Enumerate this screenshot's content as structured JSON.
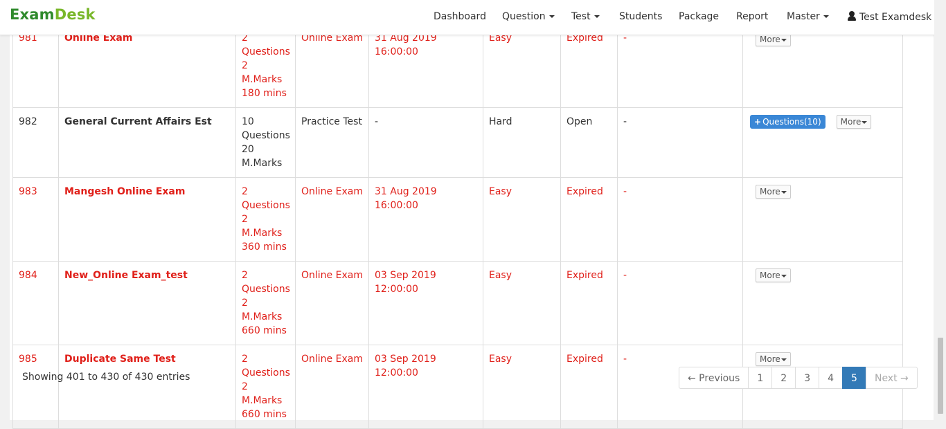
{
  "brand": {
    "name_part1": "Exam",
    "name_part2": "Desk"
  },
  "nav": {
    "dashboard": "Dashboard",
    "question": "Question",
    "test": "Test",
    "students": "Students",
    "package": "Package",
    "report": "Report",
    "master": "Master",
    "user": "Test Examdesk"
  },
  "rows": [
    {
      "id": "981",
      "title": "Online Exam",
      "q1": "2",
      "q2": "Questions",
      "q3": "2 M.Marks",
      "q4": "180 mins",
      "type": "Online Exam",
      "date": "31 Aug 2019 16:00:00",
      "level": "Easy",
      "status": "Expired",
      "extra": "-"
    },
    {
      "id": "982",
      "title": "General Current Affairs Est",
      "q1": "10",
      "q2": "Questions",
      "q3": "20",
      "q4": "M.Marks",
      "type": "Practice Test",
      "date": "-",
      "level": "Hard",
      "status": "Open",
      "extra": "-",
      "questions_button": "Questions(10)"
    },
    {
      "id": "983",
      "title": "Mangesh Online Exam",
      "q1": "2",
      "q2": "Questions",
      "q3": "2 M.Marks",
      "q4": "360 mins",
      "type": "Online Exam",
      "date": "31 Aug 2019 16:00:00",
      "level": "Easy",
      "status": "Expired",
      "extra": "-"
    },
    {
      "id": "984",
      "title": "New_Online Exam_test",
      "q1": "2",
      "q2": "Questions",
      "q3": "2 M.Marks",
      "q4": "660 mins",
      "type": "Online Exam",
      "date": "03 Sep 2019 12:00:00",
      "level": "Easy",
      "status": "Expired",
      "extra": "-"
    },
    {
      "id": "985",
      "title": "Duplicate Same Test",
      "q1": "2",
      "q2": "Questions",
      "q3": "2 M.Marks",
      "q4": "660 mins",
      "type": "Online Exam",
      "date": "03 Sep 2019 12:00:00",
      "level": "Easy",
      "status": "Expired",
      "extra": "-"
    }
  ],
  "more_label": "More",
  "info": "Showing 401 to 430 of 430 entries",
  "pagination": {
    "previous": "← Previous",
    "p1": "1",
    "p2": "2",
    "p3": "3",
    "p4": "4",
    "p5": "5",
    "next": "Next →"
  },
  "colors": {
    "expired": "#e0201a",
    "brand_dark": "#2f8a2c",
    "brand_light": "#79b72a",
    "active_page": "#337ab7"
  }
}
